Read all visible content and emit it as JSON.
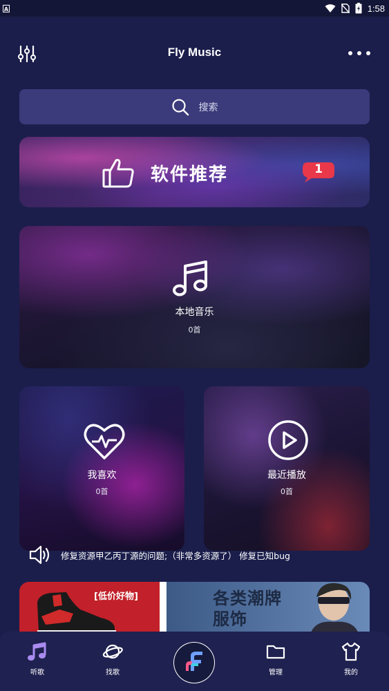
{
  "status_bar": {
    "time": "1:58",
    "left_icon": "notification-a-icon",
    "right_icons": [
      "wifi-icon",
      "no-sim-icon",
      "battery-charging-icon"
    ]
  },
  "header": {
    "title": "Fly Music",
    "left_icon": "equalizer-icon",
    "right_icon": "more-dots-icon"
  },
  "search": {
    "placeholder": "搜索",
    "icon": "search-icon"
  },
  "recommend": {
    "label": "软件推荐",
    "icon": "thumbs-up-icon",
    "badge_count": "1"
  },
  "cards": {
    "local": {
      "title": "本地音乐",
      "count": "0首",
      "icon": "music-note-icon"
    },
    "favorites": {
      "title": "我喜欢",
      "count": "0首",
      "icon": "heart-pulse-icon"
    },
    "recent": {
      "title": "最近播放",
      "count": "0首",
      "icon": "play-circle-icon"
    }
  },
  "notice": {
    "icon": "speaker-icon",
    "text": "修复资源甲乙丙丁源的问题;（非常多资源了） 修复已知bug"
  },
  "ad": {
    "tag": "[低价好物]",
    "line1": "各类潮牌",
    "line2": "服饰"
  },
  "bottom_nav": {
    "items": [
      {
        "label": "听歌",
        "icon": "music-note-icon"
      },
      {
        "label": "找歌",
        "icon": "planet-icon"
      },
      {
        "label": "",
        "icon": "fly-logo-icon"
      },
      {
        "label": "管理",
        "icon": "folder-icon"
      },
      {
        "label": "我的",
        "icon": "tshirt-icon"
      }
    ]
  },
  "colors": {
    "background": "#1b1e4b",
    "search_bg": "#3b3a7a",
    "badge": "#e8384a",
    "nav_bg": "#1f2150",
    "nav_active": "#a98cf0"
  }
}
